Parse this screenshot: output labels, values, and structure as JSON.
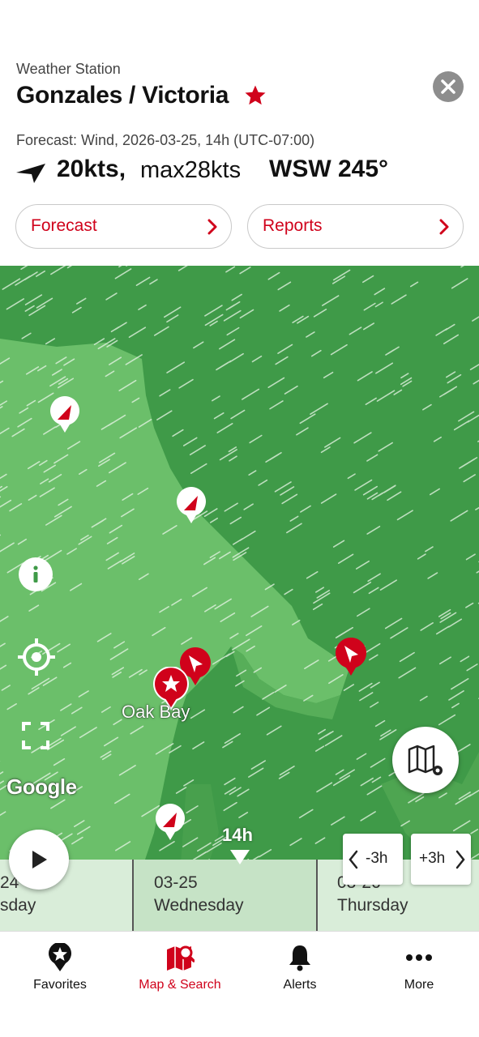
{
  "header": {
    "station_type": "Weather Station",
    "station_name": "Gonzales / Victoria",
    "forecast_line": "Forecast: Wind, 2026-03-25, 14h (UTC-07:00)",
    "wind_speed": "20kts,",
    "wind_max": "max28kts",
    "wind_direction": "WSW 245°",
    "favorite_icon": "star-icon",
    "close_icon": "close-icon",
    "direction_icon": "wind-arrow-icon"
  },
  "buttons": {
    "forecast": "Forecast",
    "reports": "Reports"
  },
  "map": {
    "place_label": "Oak Bay",
    "attribution": "Google",
    "time_marker": "14h",
    "minus_label": "-3h",
    "plus_label": "+3h"
  },
  "timeline": [
    {
      "date": "24",
      "day": "sday"
    },
    {
      "date": "03-25",
      "day": "Wednesday"
    },
    {
      "date": "03-26",
      "day": "Thursday"
    }
  ],
  "nav": [
    {
      "label": "Favorites",
      "icon": "star-pin-icon"
    },
    {
      "label": "Map & Search",
      "icon": "map-search-icon"
    },
    {
      "label": "Alerts",
      "icon": "bell-icon"
    },
    {
      "label": "More",
      "icon": "more-dots-icon"
    }
  ],
  "colors": {
    "accent": "#d0021b",
    "water": "#3f9a48",
    "land": "#6bbf6a",
    "timeline_bg": "#d9edd9"
  }
}
